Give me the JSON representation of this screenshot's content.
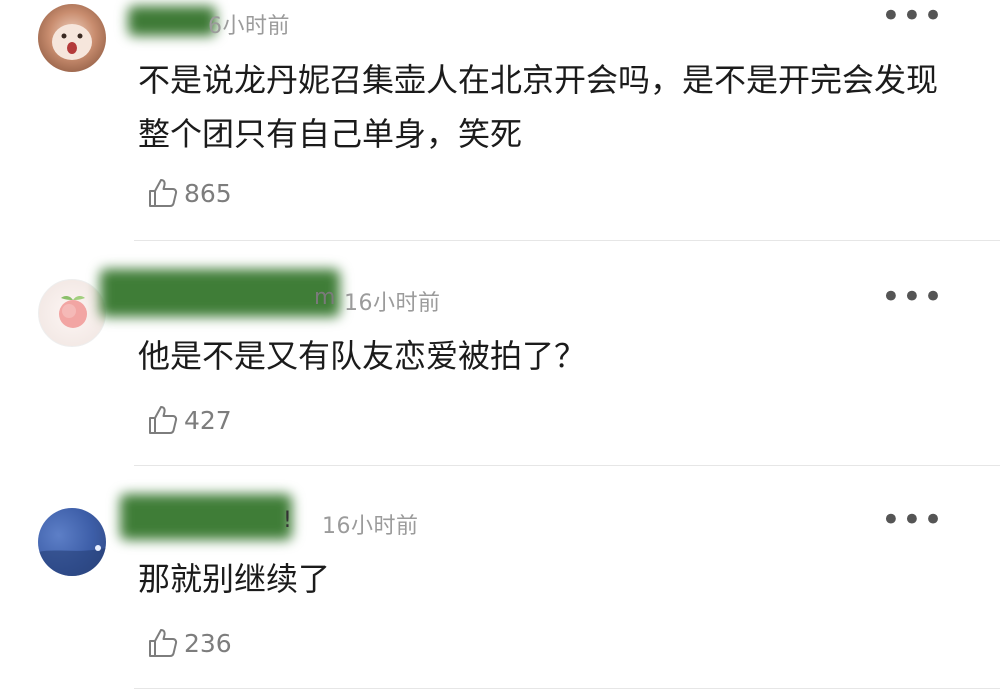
{
  "comments": [
    {
      "time": "6小时前",
      "text": "不是说龙丹妮召集壶人在北京开会吗，是不是开完会发现整个团只有自己单身，笑死",
      "likes": "865"
    },
    {
      "name_tail": "m",
      "time": "16小时前",
      "text": "他是不是又有队友恋爱被拍了？",
      "likes": "427"
    },
    {
      "name_tail": "!",
      "time": "16小时前",
      "text": "那就别继续了",
      "likes": "236"
    }
  ],
  "icons": {
    "more": "more-dots-icon",
    "like": "thumb-up-icon"
  },
  "colors": {
    "time_text": "#9b9b9b",
    "like_text": "#7d7d7d",
    "divider": "#e6e6e6",
    "name_mosaic": "#3f7d37"
  },
  "more_glyph": "•••"
}
